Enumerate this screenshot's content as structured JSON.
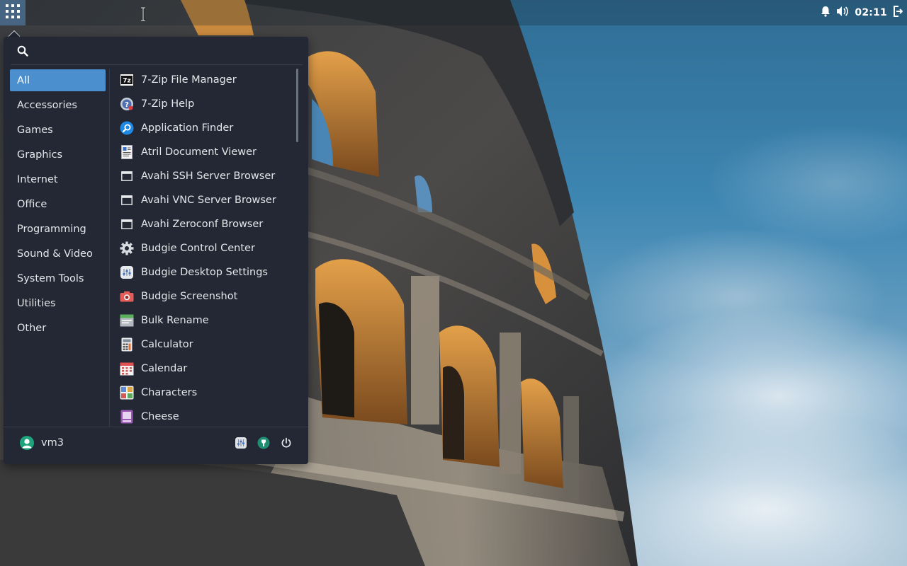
{
  "panel": {
    "clock": "02:11",
    "icons": [
      "app-grid-icon",
      "bell-icon",
      "volume-icon",
      "logout-icon"
    ]
  },
  "menu": {
    "search": {
      "value": "",
      "placeholder": ""
    },
    "categories": [
      {
        "label": "All",
        "active": true
      },
      {
        "label": "Accessories"
      },
      {
        "label": "Games"
      },
      {
        "label": "Graphics"
      },
      {
        "label": "Internet"
      },
      {
        "label": "Office"
      },
      {
        "label": "Programming"
      },
      {
        "label": "Sound & Video"
      },
      {
        "label": "System Tools"
      },
      {
        "label": "Utilities"
      },
      {
        "label": "Other"
      }
    ],
    "apps": [
      {
        "label": "7-Zip File Manager",
        "icon": "7zip-icon"
      },
      {
        "label": "7-Zip Help",
        "icon": "help-icon"
      },
      {
        "label": "Application Finder",
        "icon": "app-finder-icon"
      },
      {
        "label": "Atril Document Viewer",
        "icon": "document-viewer-icon"
      },
      {
        "label": "Avahi SSH Server Browser",
        "icon": "network-browser-icon"
      },
      {
        "label": "Avahi VNC Server Browser",
        "icon": "network-browser-icon"
      },
      {
        "label": "Avahi Zeroconf Browser",
        "icon": "network-browser-icon"
      },
      {
        "label": "Budgie Control Center",
        "icon": "gear-icon"
      },
      {
        "label": "Budgie Desktop Settings",
        "icon": "desktop-settings-icon"
      },
      {
        "label": "Budgie Screenshot",
        "icon": "camera-icon"
      },
      {
        "label": "Bulk Rename",
        "icon": "bulk-rename-icon"
      },
      {
        "label": "Calculator",
        "icon": "calculator-icon"
      },
      {
        "label": "Calendar",
        "icon": "calendar-icon"
      },
      {
        "label": "Characters",
        "icon": "characters-icon"
      },
      {
        "label": "Cheese",
        "icon": "cheese-icon"
      }
    ],
    "footer": {
      "user_name": "vm3",
      "buttons": [
        "settings-icon",
        "control-center-icon",
        "power-icon"
      ]
    }
  },
  "colors": {
    "menu_bg": "#232834",
    "accent": "#4b8fcf",
    "text": "#e4e6ea",
    "avatar": "#1fa37c"
  }
}
